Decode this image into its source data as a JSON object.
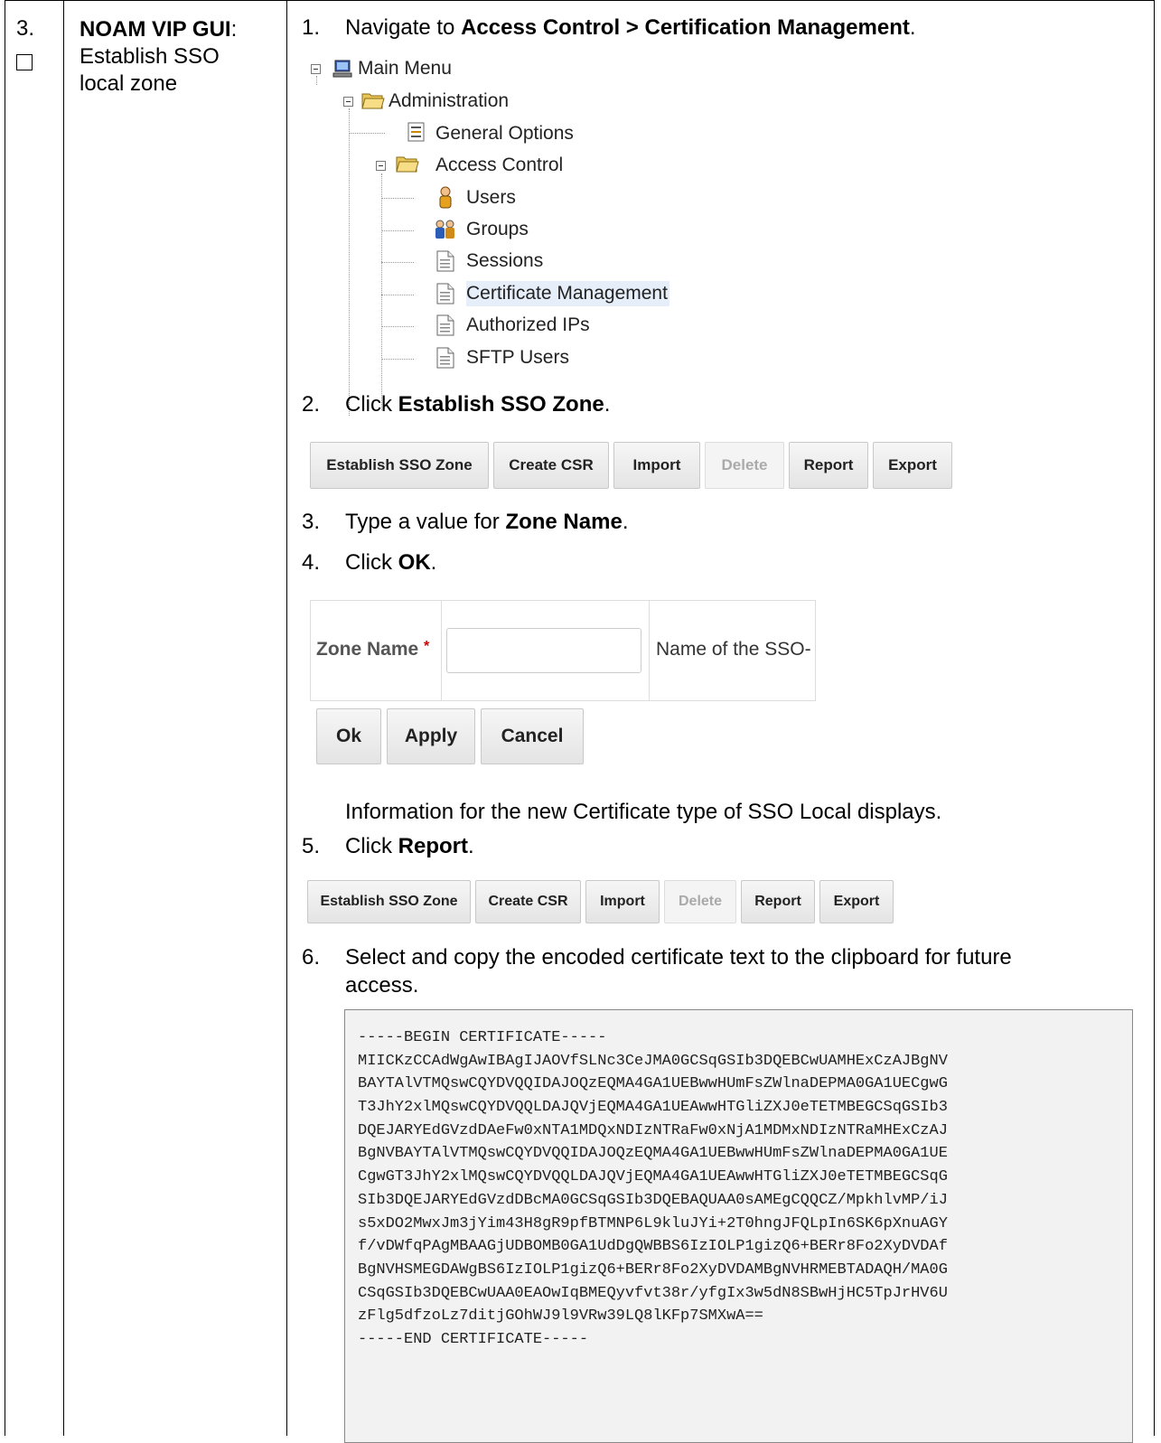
{
  "step": {
    "number": "3.",
    "title_bold": "NOAM VIP GUI",
    "title_rest": ": Establish SSO local zone"
  },
  "instructions": {
    "s1": {
      "n": "1.",
      "pre": "Navigate to ",
      "bold": "Access Control > Certification Management",
      "post": "."
    },
    "s2": {
      "n": "2.",
      "pre": "Click ",
      "bold": "Establish SSO Zone",
      "post": "."
    },
    "s3": {
      "n": "3.",
      "pre": "Type a value for ",
      "bold": "Zone Name",
      "post": "."
    },
    "s4": {
      "n": "4.",
      "pre": "Click ",
      "bold": "OK",
      "post": "."
    },
    "info": "Information for the new Certificate type of SSO Local displays.",
    "s5": {
      "n": "5.",
      "pre": "Click ",
      "bold": "Report",
      "post": "."
    },
    "s6": {
      "n": "6.",
      "line1": "Select and copy the encoded certificate text to the clipboard for future",
      "line2": "access."
    }
  },
  "tree": {
    "main_menu": "Main Menu",
    "administration": "Administration",
    "general_options": "General Options",
    "access_control": "Access Control",
    "users": "Users",
    "groups": "Groups",
    "sessions": "Sessions",
    "certificate_management": "Certificate Management",
    "authorized_ips": "Authorized IPs",
    "sftp_users": "SFTP Users"
  },
  "toolbar": {
    "establish": "Establish SSO Zone",
    "create_csr": "Create CSR",
    "import": "Import",
    "delete": "Delete",
    "report": "Report",
    "export": "Export"
  },
  "zone_form": {
    "label": "Zone Name",
    "required_mark": "*",
    "value": "",
    "description": "Name of the SSO-",
    "ok": "Ok",
    "apply": "Apply",
    "cancel": "Cancel"
  },
  "certificate": [
    "-----BEGIN CERTIFICATE-----",
    "MIICKzCCAdWgAwIBAgIJAOVfSLNc3CeJMA0GCSqGSIb3DQEBCwUAMHExCzAJBgNV",
    "BAYTAlVTMQswCQYDVQQIDAJOQzEQMA4GA1UEBwwHUmFsZWlnaDEPMA0GA1UECgwG",
    "T3JhY2xlMQswCQYDVQQLDAJQVjEQMA4GA1UEAwwHTGliZXJ0eTETMBEGCSqGSIb3",
    "DQEJARYEdGVzdDAeFw0xNTA1MDQxNDIzNTRaFw0xNjA1MDMxNDIzNTRaMHExCzAJ",
    "BgNVBAYTAlVTMQswCQYDVQQIDAJOQzEQMA4GA1UEBwwHUmFsZWlnaDEPMA0GA1UE",
    "CgwGT3JhY2xlMQswCQYDVQQLDAJQVjEQMA4GA1UEAwwHTGliZXJ0eTETMBEGCSqG",
    "SIb3DQEJARYEdGVzdDBcMA0GCSqGSIb3DQEBAQUAA0sAMEgCQQCZ/MpkhlvMP/iJ",
    "s5xDO2MwxJm3jYim43H8gR9pfBTMNP6L9kluJYi+2T0hngJFQLpIn6SK6pXnuAGY",
    "f/vDWfqPAgMBAAGjUDBOMB0GA1UdDgQWBBS6IzIOLP1gizQ6+BERr8Fo2XyDVDAf",
    "BgNVHSMEGDAWgBS6IzIOLP1gizQ6+BERr8Fo2XyDVDAMBgNVHRMEBTADAQH/MA0G",
    "CSqGSIb3DQEBCwUAA0EAOwIqBMEQyvfvt38r/yfgIx3w5dN8SBwHjHC5TpJrHV6U",
    "zFlg5dfzoLz7ditjGOhWJ9l9VRw39LQ8lKFp7SMXwA==",
    "-----END CERTIFICATE-----"
  ]
}
